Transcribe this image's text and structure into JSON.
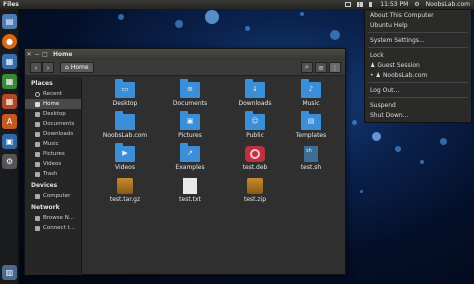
{
  "panel": {
    "app_title": "Files",
    "clock": "11:53 PM",
    "user": "NoobsLab.com"
  },
  "launcher": {
    "items": [
      "folder",
      "firefox",
      "document",
      "spreadsheet",
      "presentation",
      "software-center",
      "cart",
      "settings",
      "trash"
    ]
  },
  "window": {
    "title": "Home",
    "path_label": "Home"
  },
  "sidebar": {
    "places_heading": "Places",
    "places": [
      "Recent",
      "Home",
      "Desktop",
      "Documents",
      "Downloads",
      "Music",
      "Pictures",
      "Videos",
      "Trash"
    ],
    "devices_heading": "Devices",
    "devices": [
      "Computer"
    ],
    "network_heading": "Network",
    "network": [
      "Browse N...",
      "Connect t..."
    ]
  },
  "files": [
    {
      "name": "Desktop",
      "kind": "folder"
    },
    {
      "name": "Documents",
      "kind": "folder"
    },
    {
      "name": "Downloads",
      "kind": "folder"
    },
    {
      "name": "Music",
      "kind": "folder"
    },
    {
      "name": "NoobsLab.com",
      "kind": "folder"
    },
    {
      "name": "Pictures",
      "kind": "folder"
    },
    {
      "name": "Public",
      "kind": "folder"
    },
    {
      "name": "Templates",
      "kind": "folder"
    },
    {
      "name": "Videos",
      "kind": "folder"
    },
    {
      "name": "Examples",
      "kind": "folder"
    },
    {
      "name": "test.deb",
      "kind": "deb"
    },
    {
      "name": "test.sh",
      "kind": "script"
    },
    {
      "name": "test.tar.gz",
      "kind": "archive"
    },
    {
      "name": "test.txt",
      "kind": "text"
    },
    {
      "name": "test.zip",
      "kind": "archive"
    }
  ],
  "session_menu": {
    "items": [
      "About This Computer",
      "Ubuntu Help",
      "System Settings...",
      "Lock",
      "Guest Session",
      "NoobsLab.com",
      "Log Out...",
      "Suspend",
      "Shut Down..."
    ]
  },
  "colors": {
    "accent": "#3b8fd8",
    "panel": "#2f2e2a"
  }
}
